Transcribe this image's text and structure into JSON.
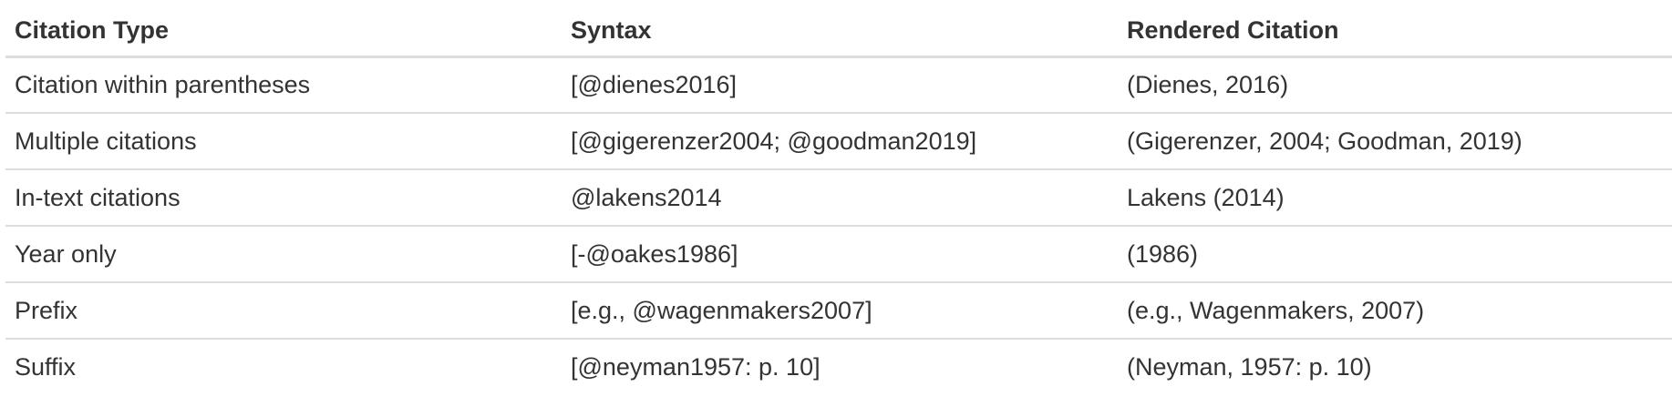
{
  "table": {
    "headers": [
      "Citation Type",
      "Syntax",
      "Rendered Citation"
    ],
    "rows": [
      [
        "Citation within parentheses",
        "[@dienes2016]",
        "(Dienes, 2016)"
      ],
      [
        "Multiple citations",
        "[@gigerenzer2004; @goodman2019]",
        "(Gigerenzer, 2004; Goodman, 2019)"
      ],
      [
        "In-text citations",
        "@lakens2014",
        "Lakens (2014)"
      ],
      [
        "Year only",
        "[-@oakes1986]",
        "(1986)"
      ],
      [
        "Prefix",
        "[e.g., @wagenmakers2007]",
        "(e.g., Wagenmakers, 2007)"
      ],
      [
        "Suffix",
        "[@neyman1957: p. 10]",
        "(Neyman, 1957: p. 10)"
      ]
    ]
  }
}
